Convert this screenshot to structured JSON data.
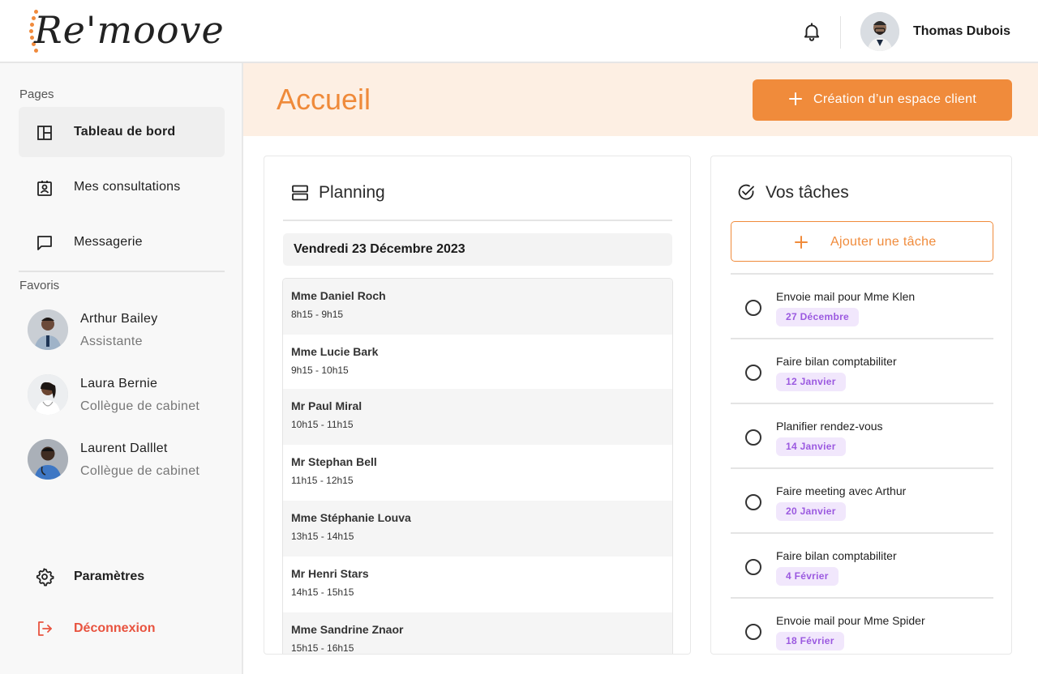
{
  "header": {
    "brand": "Re'moove",
    "user_name": "Thomas Dubois"
  },
  "sidebar": {
    "pages_title": "Pages",
    "items": [
      {
        "label": "Tableau de bord",
        "icon": "dashboard-icon",
        "active": true
      },
      {
        "label": "Mes consultations",
        "icon": "contact-badge-icon",
        "active": false
      },
      {
        "label": "Messagerie",
        "icon": "chat-icon",
        "active": false
      }
    ],
    "favorites_title": "Favoris",
    "favorites": [
      {
        "name": "Arthur Bailey",
        "role": "Assistante"
      },
      {
        "name": "Laura Bernie",
        "role": "Collègue de cabinet"
      },
      {
        "name": "Laurent Dalllet",
        "role": "Collègue de cabinet"
      }
    ],
    "settings_label": "Paramètres",
    "logout_label": "Déconnexion"
  },
  "main": {
    "title": "Accueil",
    "cta_label": "Création d’un espace client"
  },
  "planning": {
    "title": "Planning",
    "date": "Vendredi 23 Décembre 2023",
    "appointments": [
      {
        "name": "Mme Daniel Roch",
        "time": "8h15 - 9h15"
      },
      {
        "name": "Mme Lucie Bark",
        "time": "9h15 - 10h15"
      },
      {
        "name": "Mr Paul Miral",
        "time": "10h15 - 11h15"
      },
      {
        "name": "Mr Stephan Bell",
        "time": "11h15 - 12h15"
      },
      {
        "name": "Mme Stéphanie Louva",
        "time": "13h15 - 14h15"
      },
      {
        "name": "Mr Henri Stars",
        "time": "14h15 - 15h15"
      },
      {
        "name": "Mme Sandrine Znaor",
        "time": "15h15 - 16h15"
      }
    ]
  },
  "tasks": {
    "title": "Vos tâches",
    "add_label": "Ajouter une tâche",
    "items": [
      {
        "label": "Envoie mail pour Mme Klen",
        "due": "27 Décembre"
      },
      {
        "label": "Faire bilan comptabiliter",
        "due": "12 Janvier"
      },
      {
        "label": "Planifier rendez-vous",
        "due": "14 Janvier"
      },
      {
        "label": "Faire meeting avec Arthur",
        "due": "20 Janvier"
      },
      {
        "label": "Faire bilan comptabiliter",
        "due": "4 Février"
      },
      {
        "label": "Envoie mail pour Mme Spider",
        "due": "18 Février"
      }
    ]
  },
  "colors": {
    "accent": "#f08b3b",
    "banner_bg": "#fdefe3",
    "badge_bg": "#f1e7fc",
    "badge_text": "#9b59e0",
    "logout": "#e8533f"
  }
}
